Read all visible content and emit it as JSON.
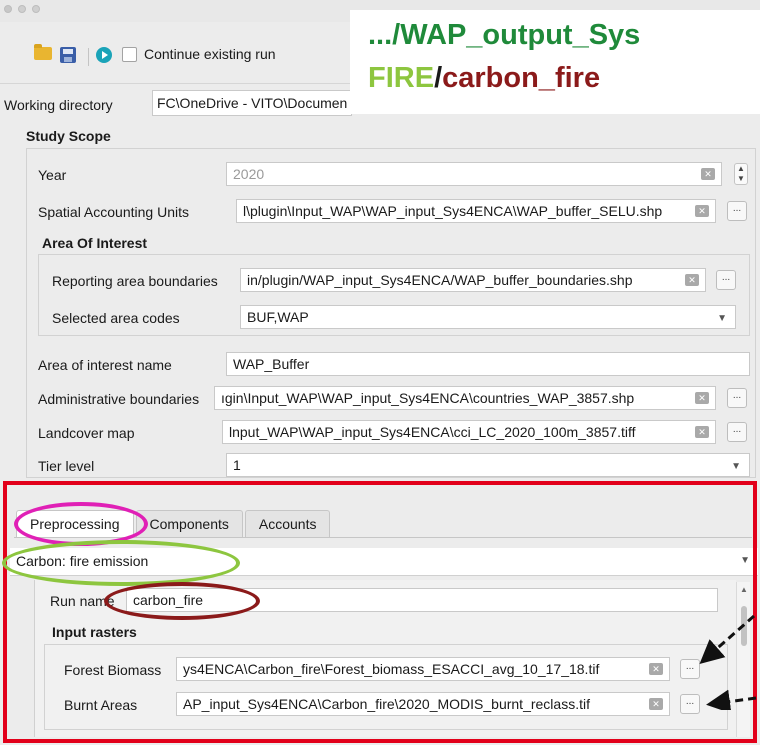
{
  "toolbar": {
    "continue_label": "Continue existing run"
  },
  "overlay": {
    "line1": ".../WAP_output_Sys",
    "line2_a": "FIRE",
    "line2_b": "/",
    "line2_c": "carbon_fire",
    "colors": {
      "green": "#1f8a3a",
      "light_green": "#8dc63f",
      "maroon": "#8b1a1a"
    }
  },
  "working_directory": {
    "label": "Working directory",
    "value": "FC\\OneDrive - VITO\\Documen"
  },
  "study_scope": {
    "title": "Study Scope",
    "year_label": "Year",
    "year_value": "2020",
    "sau_label": "Spatial Accounting Units",
    "sau_value": "l\\plugin\\Input_WAP\\WAP_input_Sys4ENCA\\WAP_buffer_SELU.shp",
    "aoi": {
      "title": "Area Of Interest",
      "reporting_label": "Reporting area boundaries",
      "reporting_value": "in/plugin/WAP_input_Sys4ENCA/WAP_buffer_boundaries.shp",
      "codes_label": "Selected area codes",
      "codes_value": "BUF,WAP"
    },
    "aoi_name_label": "Area of interest name",
    "aoi_name_value": "WAP_Buffer",
    "admin_label": "Administrative boundaries",
    "admin_value": "ıgin\\Input_WAP\\WAP_input_Sys4ENCA\\countries_WAP_3857.shp",
    "landcover_label": "Landcover map",
    "landcover_value": "lnput_WAP\\WAP_input_Sys4ENCA\\cci_LC_2020_100m_3857.tiff",
    "tier_label": "Tier level",
    "tier_value": "1"
  },
  "tabs": [
    "Preprocessing",
    "Components",
    "Accounts"
  ],
  "preprocessing": {
    "mode": "Carbon: fire emission",
    "run_name_label": "Run name",
    "run_name_value": "carbon_fire",
    "input_rasters_title": "Input rasters",
    "forest_label": "Forest Biomass",
    "forest_value": "ys4ENCA\\Carbon_fire\\Forest_biomass_ESACCI_avg_10_17_18.tif",
    "burnt_label": "Burnt Areas",
    "burnt_value": "AP_input_Sys4ENCA\\Carbon_fire\\2020_MODIS_burnt_reclass.tif"
  },
  "annotation_colors": {
    "frame": "#e2001a",
    "pink": "#e020b6",
    "green": "#8dc63f",
    "maroon": "#8b1a1a"
  }
}
